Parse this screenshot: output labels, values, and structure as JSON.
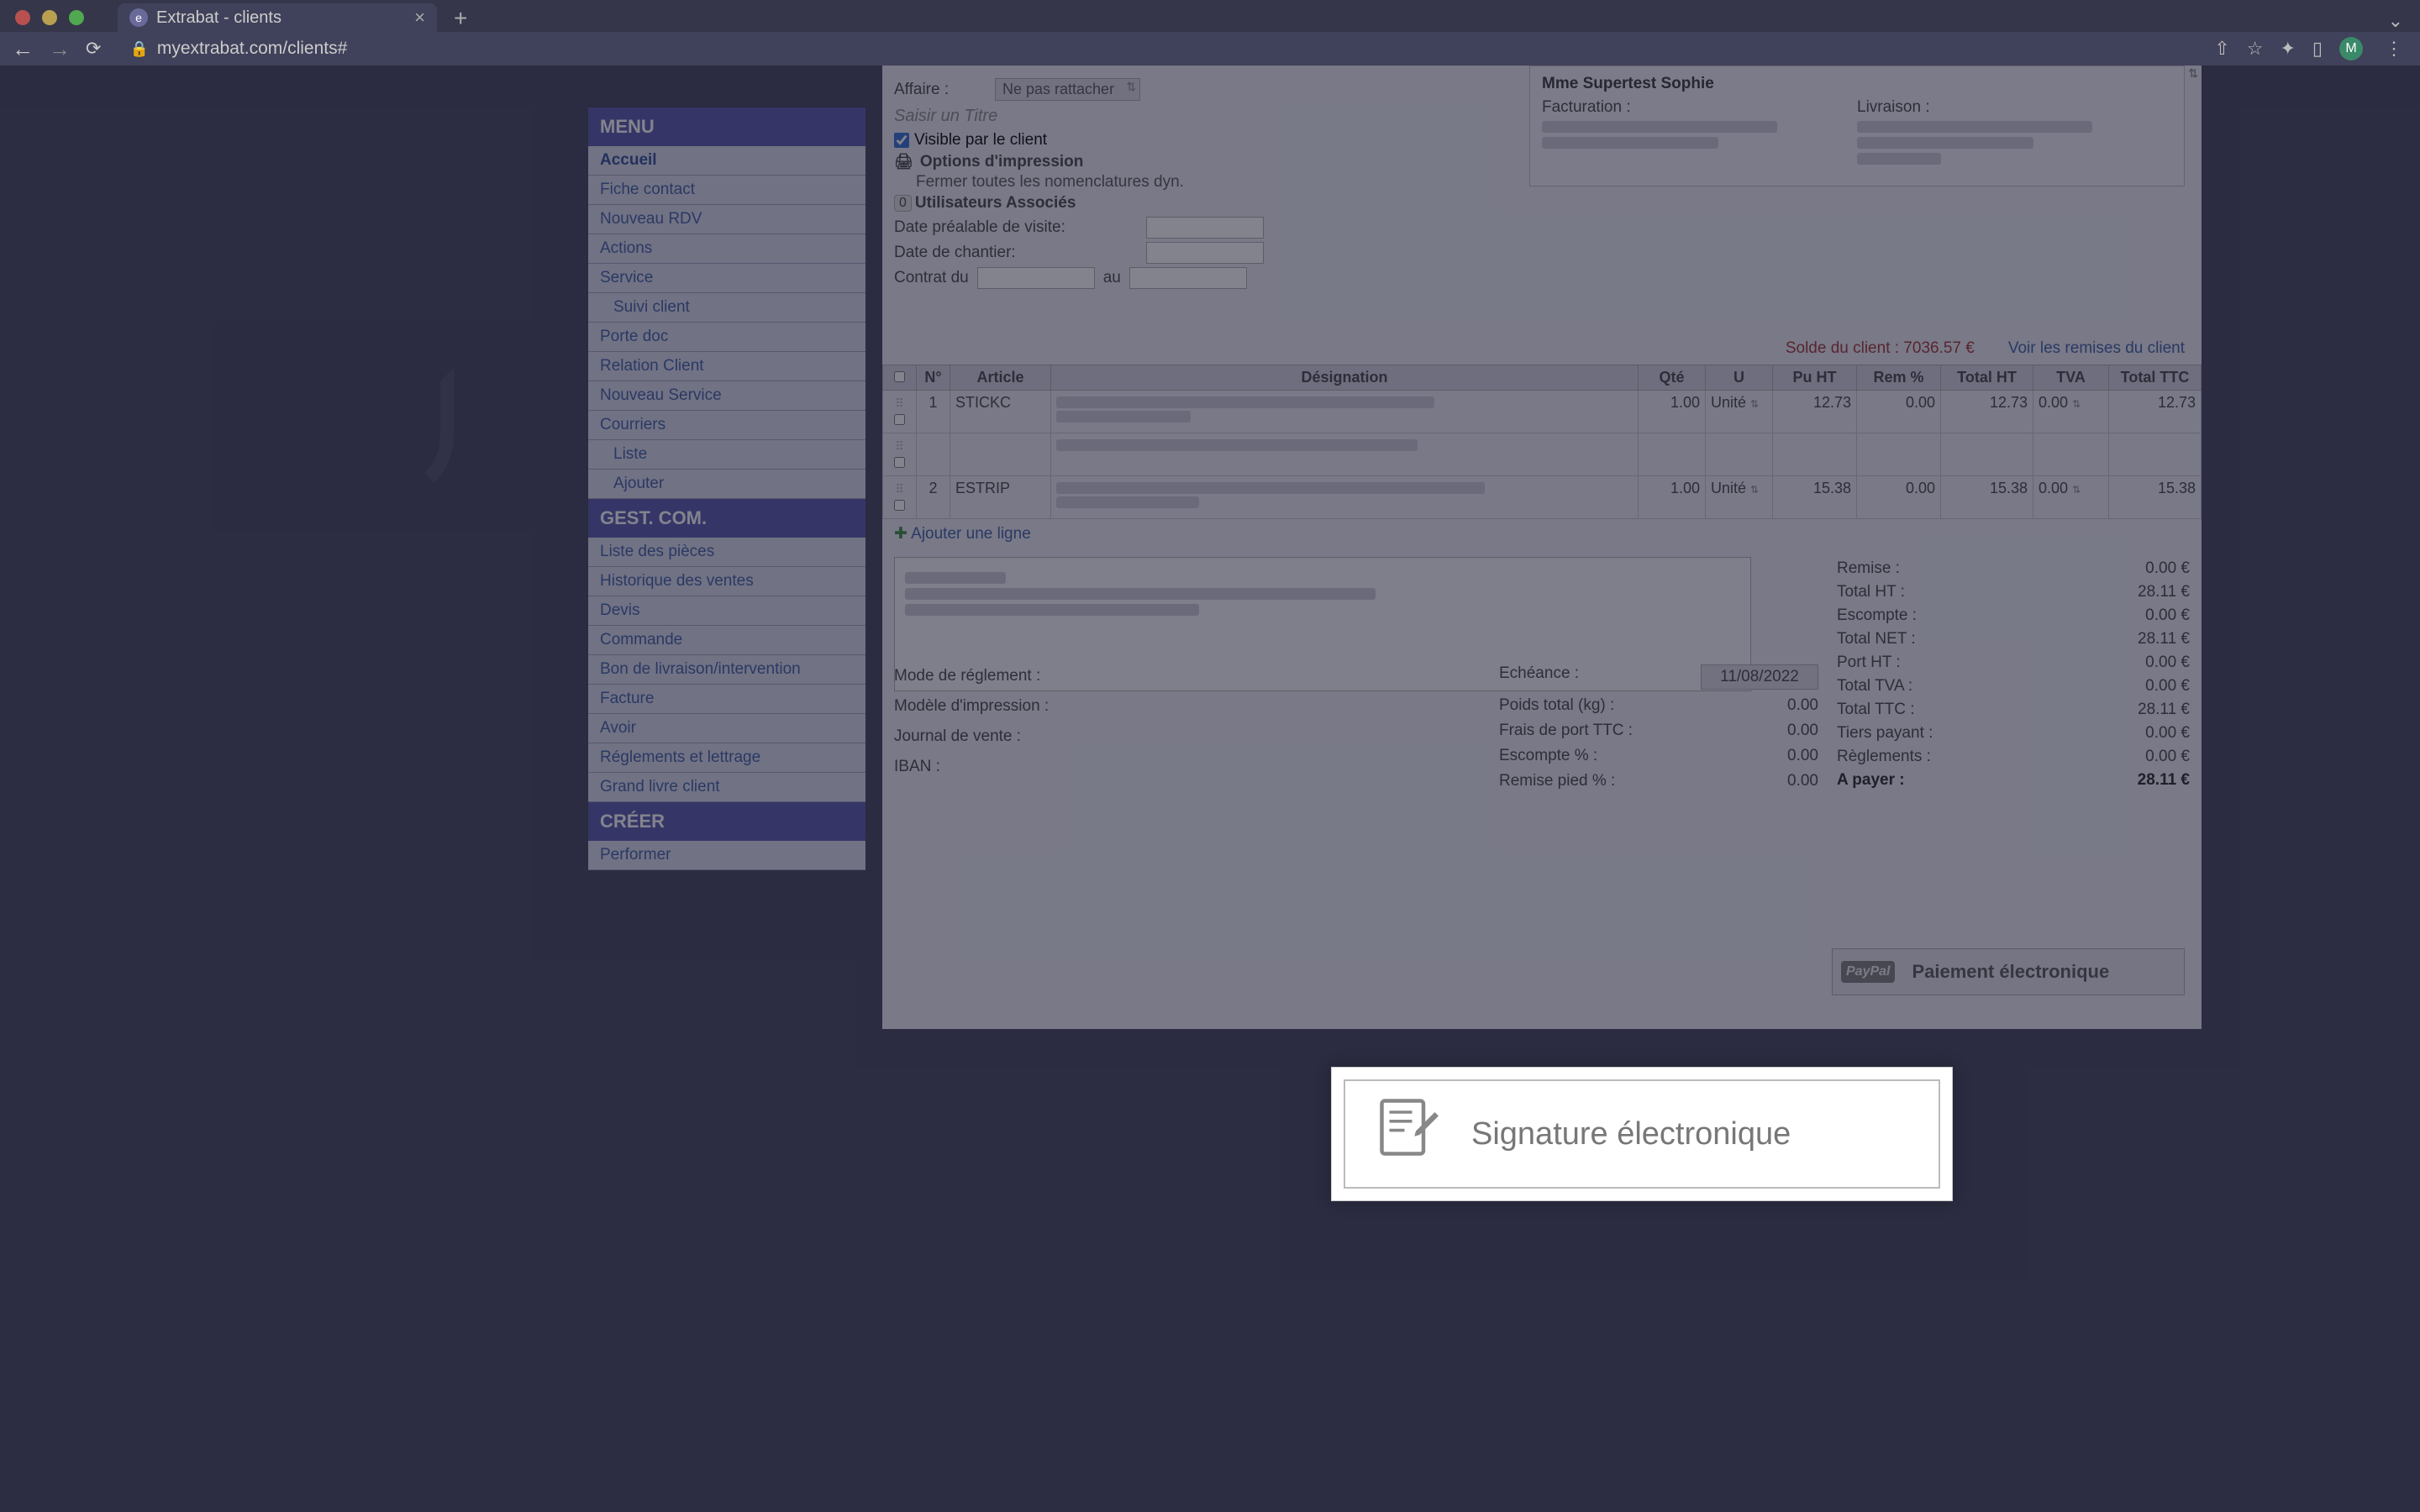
{
  "browser": {
    "tab_title": "Extrabat - clients",
    "url": "myextrabat.com/clients#",
    "avatar_initial": "M"
  },
  "sidebar": {
    "sections": {
      "menu": {
        "title": "MENU",
        "items": [
          {
            "label": "Accueil",
            "active": true
          },
          {
            "label": "Fiche contact"
          },
          {
            "label": "Nouveau RDV"
          },
          {
            "label": "Actions"
          },
          {
            "label": "Service"
          },
          {
            "label": "Suivi client",
            "sub": true
          },
          {
            "label": "Porte doc"
          },
          {
            "label": "Relation Client"
          },
          {
            "label": "Nouveau Service"
          },
          {
            "label": "Courriers"
          },
          {
            "label": "Liste",
            "sub": true
          },
          {
            "label": "Ajouter",
            "sub": true
          }
        ]
      },
      "gestcom": {
        "title": "GEST. COM.",
        "items": [
          {
            "label": "Liste des pièces"
          },
          {
            "label": "Historique des ventes"
          },
          {
            "label": "Devis"
          },
          {
            "label": "Commande"
          },
          {
            "label": "Bon de livraison/intervention"
          },
          {
            "label": "Facture"
          },
          {
            "label": "Avoir"
          },
          {
            "label": "Réglements et lettrage"
          },
          {
            "label": "Grand livre client"
          }
        ]
      },
      "creer": {
        "title": "CRÉER",
        "items": [
          {
            "label": "Performer"
          }
        ]
      }
    }
  },
  "form": {
    "affaire_label": "Affaire :",
    "affaire_value": "Ne pas rattacher",
    "title_placeholder": "Saisir un Titre",
    "visible_client": "Visible par le client",
    "print_options": "Options d'impression",
    "close_nomenclatures": "Fermer toutes les nomenclatures dyn.",
    "users_count": "0",
    "users_label": "Utilisateurs Associés",
    "date_prealable": "Date préalable de visite:",
    "date_chantier": "Date de chantier:",
    "contrat_du": "Contrat du",
    "au": "au"
  },
  "client": {
    "name": "Mme Supertest Sophie",
    "facturation_label": "Facturation :",
    "livraison_label": "Livraison :"
  },
  "balance": {
    "solde": "Solde du client : 7036.57 €",
    "remises": "Voir les remises du client"
  },
  "table": {
    "headers": {
      "chk": "",
      "num": "N°",
      "article": "Article",
      "designation": "Désignation",
      "qte": "Qté",
      "u": "U",
      "puht": "Pu HT",
      "rem": "Rem %",
      "totalht": "Total HT",
      "tva": "TVA",
      "totalttc": "Total TTC"
    },
    "rows": [
      {
        "num": "1",
        "article": "STICKC",
        "qte": "1.00",
        "u": "Unité",
        "puht": "12.73",
        "rem": "0.00",
        "totalht": "12.73",
        "tva": "0.00",
        "totalttc": "12.73"
      },
      {
        "num": "",
        "article": "",
        "qte": "",
        "u": "",
        "puht": "",
        "rem": "",
        "totalht": "",
        "tva": "",
        "totalttc": ""
      },
      {
        "num": "2",
        "article": "ESTRIP",
        "qte": "1.00",
        "u": "Unité",
        "puht": "15.38",
        "rem": "0.00",
        "totalht": "15.38",
        "tva": "0.00",
        "totalttc": "15.38"
      }
    ],
    "add_line": "Ajouter une ligne"
  },
  "params": {
    "mode_reglement": "Mode de réglement :",
    "modele_impression": "Modèle d'impression :",
    "journal_vente": "Journal de vente :",
    "iban": "IBAN :",
    "echeance": "Echéance :",
    "echeance_value": "11/08/2022",
    "poids": "Poids total (kg) :",
    "poids_value": "0.00",
    "frais_port": "Frais de port TTC :",
    "frais_port_value": "0.00",
    "escompte": "Escompte % :",
    "escompte_value": "0.00",
    "remise_pied": "Remise pied % :",
    "remise_pied_value": "0.00"
  },
  "totals": {
    "remise": {
      "label": "Remise :",
      "value": "0.00 €"
    },
    "totalht": {
      "label": "Total HT :",
      "value": "28.11 €"
    },
    "escompte": {
      "label": "Escompte :",
      "value": "0.00 €"
    },
    "totalnet": {
      "label": "Total NET :",
      "value": "28.11 €"
    },
    "portht": {
      "label": "Port HT :",
      "value": "0.00 €"
    },
    "totaltva": {
      "label": "Total TVA :",
      "value": "0.00 €"
    },
    "totalttc": {
      "label": "Total TTC :",
      "value": "28.11 €"
    },
    "tiers": {
      "label": "Tiers payant :",
      "value": "0.00 €"
    },
    "reglements": {
      "label": "Règlements :",
      "value": "0.00 €"
    },
    "apayer": {
      "label": "A payer :",
      "value": "28.11 €"
    }
  },
  "signature": {
    "label": "Signature électronique"
  },
  "payment": {
    "paypal": "PayPal",
    "label": "Paiement électronique"
  }
}
